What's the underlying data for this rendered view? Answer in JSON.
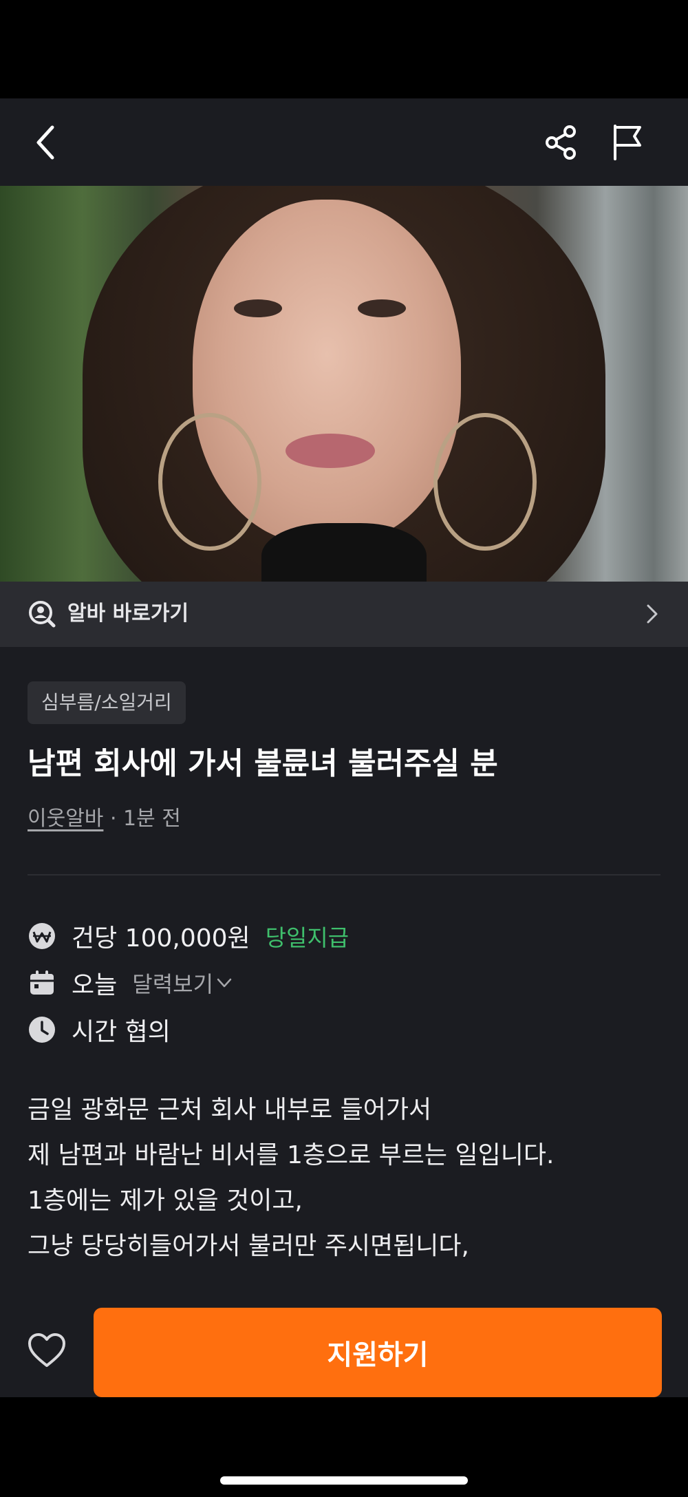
{
  "nav": {
    "back_icon": "chevron-left-icon",
    "share_icon": "share-icon",
    "report_icon": "flag-icon"
  },
  "hero": {
    "image_description": "photo",
    "carousel_total": 1,
    "carousel_active": 1
  },
  "shortcut": {
    "icon": "person-search-icon",
    "label": "알바 바로가기",
    "chevron_icon": "chevron-right-icon"
  },
  "post": {
    "category": "심부름/소일거리",
    "title": "남편 회사에 가서 불륜녀 불러주실 분",
    "author": "이웃알바",
    "time_ago": "· 1분 전"
  },
  "info": {
    "pay": {
      "icon": "won-icon",
      "text": "건당 100,000원",
      "badge": "당일지급"
    },
    "date": {
      "icon": "calendar-icon",
      "text": "오늘",
      "link": "달력보기"
    },
    "time": {
      "icon": "clock-icon",
      "text": "시간 협의"
    }
  },
  "description": [
    "금일 광화문 근처 회사 내부로 들어가서",
    "제 남편과 바람난 비서를 1층으로 부르는 일입니다.",
    "1층에는 제가 있을 것이고,",
    "그냥 당당히들어가서 불러만 주시면됩니다,"
  ],
  "bottom": {
    "like_icon": "heart-icon",
    "apply_label": "지원하기"
  },
  "colors": {
    "accent": "#ff6f0f",
    "badge_green": "#3fbf6c",
    "background": "#1b1c21"
  }
}
